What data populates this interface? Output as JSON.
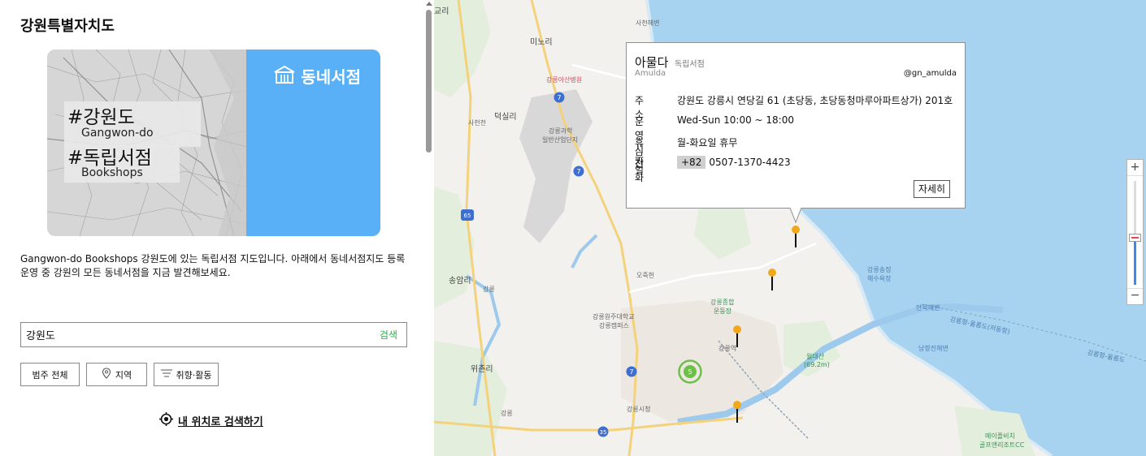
{
  "page": {
    "title": "강원특별자치도",
    "description": "Gangwon-do Bookshops 강원도에 있는 독립서점 지도입니다. 아래에서 동네서점지도 등록 운영 중 강원의 모든 동네서점을 지금 발견해보세요."
  },
  "banner": {
    "logo_text": "동네서점",
    "tag1_main": "#강원도",
    "tag1_sub": "Gangwon-do",
    "tag2_main": "#독립서점",
    "tag2_sub": "Bookshops",
    "accent_color": "#5ab0f7"
  },
  "search": {
    "value": "강원도",
    "button_label": "검색"
  },
  "filters": {
    "category": "범주 전체",
    "region": "지역",
    "taste": "취향·활동"
  },
  "my_location_label": "내 위치로 검색하기",
  "map": {
    "labels": {
      "goli": "교리",
      "sacheon_beach": "사천해변",
      "minori": "미노리",
      "hospital": "강릉아산병원",
      "deoksilli": "덕실리",
      "sacheoncheon": "사천천",
      "industrial_1": "강릉과학",
      "industrial_2": "일반산업단지",
      "songamri": "송암리",
      "gangneung_ic": "강릉",
      "ojukheon": "오죽헌",
      "sports_park_1": "강릉종합",
      "sports_park_2": "운동장",
      "univ_1": "강릉원주대학교",
      "univ_2": "강릉캠퍼스",
      "station": "강릉역",
      "wolhwa_1": "월대산",
      "wolhwa_2": "(69.2m)",
      "wichonri": "위촌리",
      "cityhall": "강릉시청",
      "gangneung_ic2": "강릉",
      "songjeong_1": "강릉송정",
      "songjeong_2": "해수욕장",
      "anmok": "안목해변",
      "ferry1": "강릉항-울릉도(저동항)",
      "ferry2": "강릉항-울릉도",
      "namhangjin": "남항진해변",
      "resort_1": "메이플비치",
      "resort_2": "골프앤리조트CC",
      "route7_a": "7",
      "route7_b": "7",
      "route7_c": "7",
      "route65": "65",
      "route35": "35",
      "route7_d": "7"
    },
    "cluster_count": "5",
    "zoom": {
      "in_label": "+",
      "out_label": "−",
      "level_fraction": 0.45
    }
  },
  "popup": {
    "name": "아물다",
    "category": "독립서점",
    "english_name": "Amulda",
    "instagram": "@gn_amulda",
    "address_label": "주소",
    "address": "강원도 강릉시 연당길 61 (초당동, 초당동청마루아파트상가) 201호",
    "hours_label": "운영시간",
    "hours": "Wed-Sun 10:00 ~ 18:00",
    "closed_label": "휴무일",
    "closed": "월-화요일 휴무",
    "phone_label": "전화",
    "phone_prefix": "+82",
    "phone": "0507-1370-4423",
    "detail_button": "자세히"
  }
}
